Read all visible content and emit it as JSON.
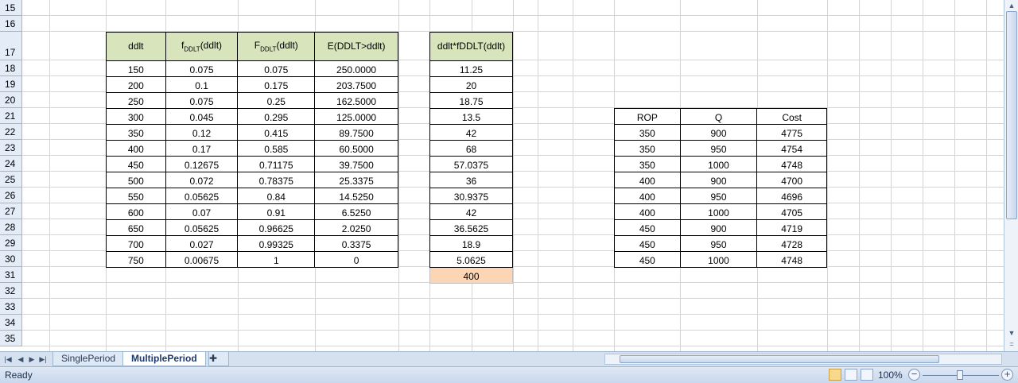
{
  "row_numbers": [
    "15",
    "16",
    "17",
    "18",
    "19",
    "20",
    "21",
    "22",
    "23",
    "24",
    "25",
    "26",
    "27",
    "28",
    "29",
    "30",
    "31",
    "32",
    "33",
    "34",
    "35"
  ],
  "table1": {
    "headers": [
      {
        "main": "ddlt",
        "sub": "",
        "tail": ""
      },
      {
        "main": "f",
        "sub": "DDLT",
        "tail": "(ddlt)"
      },
      {
        "main": "F",
        "sub": "DDLT",
        "tail": "(ddlt)"
      },
      {
        "main": "E(DDLT>ddlt)",
        "sub": "",
        "tail": ""
      }
    ],
    "rows": [
      [
        "150",
        "0.075",
        "0.075",
        "250.0000"
      ],
      [
        "200",
        "0.1",
        "0.175",
        "203.7500"
      ],
      [
        "250",
        "0.075",
        "0.25",
        "162.5000"
      ],
      [
        "300",
        "0.045",
        "0.295",
        "125.0000"
      ],
      [
        "350",
        "0.12",
        "0.415",
        "89.7500"
      ],
      [
        "400",
        "0.17",
        "0.585",
        "60.5000"
      ],
      [
        "450",
        "0.12675",
        "0.71175",
        "39.7500"
      ],
      [
        "500",
        "0.072",
        "0.78375",
        "25.3375"
      ],
      [
        "550",
        "0.05625",
        "0.84",
        "14.5250"
      ],
      [
        "600",
        "0.07",
        "0.91",
        "6.5250"
      ],
      [
        "650",
        "0.05625",
        "0.96625",
        "2.0250"
      ],
      [
        "700",
        "0.027",
        "0.99325",
        "0.3375"
      ],
      [
        "750",
        "0.00675",
        "1",
        "0"
      ]
    ]
  },
  "table2": {
    "header": "ddlt*fDDLT(ddlt)",
    "values": [
      "11.25",
      "20",
      "18.75",
      "13.5",
      "42",
      "68",
      "57.0375",
      "36",
      "30.9375",
      "42",
      "36.5625",
      "18.9",
      "5.0625"
    ],
    "total": "400",
    "total_color": "#fcd5b4"
  },
  "table3": {
    "headers": [
      "ROP",
      "Q",
      "Cost"
    ],
    "rows": [
      [
        "350",
        "900",
        "4775"
      ],
      [
        "350",
        "950",
        "4754"
      ],
      [
        "350",
        "1000",
        "4748"
      ],
      [
        "400",
        "900",
        "4700"
      ],
      [
        "400",
        "950",
        "4696"
      ],
      [
        "400",
        "1000",
        "4705"
      ],
      [
        "450",
        "900",
        "4719"
      ],
      [
        "450",
        "950",
        "4728"
      ],
      [
        "450",
        "1000",
        "4748"
      ]
    ]
  },
  "sheet_tabs": [
    {
      "label": "SinglePeriod",
      "active": false
    },
    {
      "label": "MultiplePeriod",
      "active": true
    }
  ],
  "status": {
    "text": "Ready",
    "zoom": "100%"
  },
  "colors": {
    "header_fill": "#d8e4bc",
    "total_fill": "#fcd5b4",
    "grid": "#d4d4d4"
  }
}
